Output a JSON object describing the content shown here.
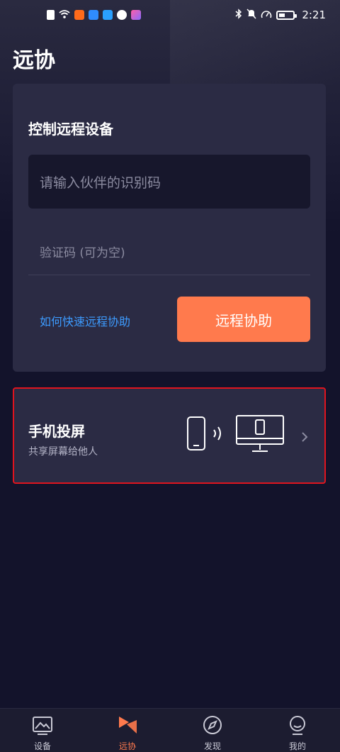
{
  "status_bar": {
    "time": "2:21"
  },
  "page": {
    "title": "远协"
  },
  "remote_control": {
    "title": "控制远程设备",
    "partner_id_placeholder": "请输入伙伴的识别码",
    "verification_placeholder": "验证码 (可为空)",
    "help_link": "如何快速远程协助",
    "assist_button": "远程协助"
  },
  "screen_cast": {
    "title": "手机投屏",
    "subtitle": "共享屏幕给他人"
  },
  "tab_bar": {
    "tabs": [
      {
        "label": "设备",
        "icon": "picture-icon",
        "active": false
      },
      {
        "label": "远协",
        "icon": "remote-assist-icon",
        "active": true
      },
      {
        "label": "发现",
        "icon": "compass-icon",
        "active": false
      },
      {
        "label": "我的",
        "icon": "profile-icon",
        "active": false
      }
    ]
  },
  "colors": {
    "accent": "#ff7a4d",
    "link": "#3d9bff",
    "background": "#13132b",
    "card": "#2b2b44",
    "highlight_border": "#e0141e"
  }
}
